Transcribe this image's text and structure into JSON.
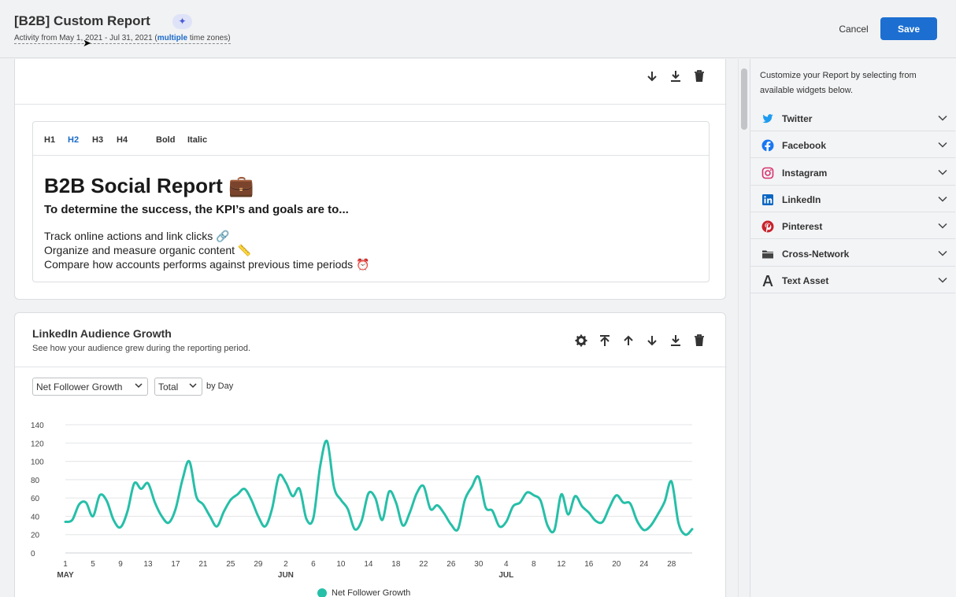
{
  "header": {
    "title": "[B2B] Custom Report",
    "subtitle_prefix": "Activity from May 1, 2021 - Jul 31, 2021 (",
    "subtitle_link": "multiple",
    "subtitle_suffix": " time zones)",
    "cancel_label": "Cancel",
    "save_label": "Save"
  },
  "editor": {
    "toolbar": [
      "H1",
      "H2",
      "H3",
      "H4",
      "Bold",
      "Italic"
    ],
    "active": "H2",
    "heading": "B2B Social Report 💼",
    "subheading": "To determine the success, the KPI’s and goals are to...",
    "lines": [
      "Track online actions and link clicks 🔗",
      "Organize and measure organic content 📏",
      "Compare how accounts performs against previous time periods ⏰"
    ]
  },
  "widget": {
    "title": "LinkedIn Audience Growth",
    "description": "See how your audience grew during the reporting period.",
    "metric_select": "Net Follower Growth",
    "aggregation_select": "Total",
    "by_label": "by Day"
  },
  "chart_data": {
    "type": "line",
    "series": [
      {
        "name": "Net Follower Growth",
        "color": "#26bfa8",
        "x": [
          "May 1",
          "May 2",
          "May 3",
          "May 4",
          "May 5",
          "May 6",
          "May 7",
          "May 8",
          "May 9",
          "May 10",
          "May 11",
          "May 12",
          "May 13",
          "May 14",
          "May 15",
          "May 16",
          "May 17",
          "May 18",
          "May 19",
          "May 20",
          "May 21",
          "May 22",
          "May 23",
          "May 24",
          "May 25",
          "May 26",
          "May 27",
          "May 28",
          "May 29",
          "May 30",
          "May 31",
          "Jun 1",
          "Jun 2",
          "Jun 3",
          "Jun 4",
          "Jun 5",
          "Jun 6",
          "Jun 7",
          "Jun 8",
          "Jun 9",
          "Jun 10",
          "Jun 11",
          "Jun 12",
          "Jun 13",
          "Jun 14",
          "Jun 15",
          "Jun 16",
          "Jun 17",
          "Jun 18",
          "Jun 19",
          "Jun 20",
          "Jun 21",
          "Jun 22",
          "Jun 23",
          "Jun 24",
          "Jun 25",
          "Jun 26",
          "Jun 27",
          "Jun 28",
          "Jun 29",
          "Jun 30",
          "Jul 1",
          "Jul 2",
          "Jul 3",
          "Jul 4",
          "Jul 5",
          "Jul 6",
          "Jul 7",
          "Jul 8",
          "Jul 9",
          "Jul 10",
          "Jul 11",
          "Jul 12",
          "Jul 13",
          "Jul 14",
          "Jul 15",
          "Jul 16",
          "Jul 17",
          "Jul 18",
          "Jul 19",
          "Jul 20",
          "Jul 21",
          "Jul 22",
          "Jul 23",
          "Jul 24",
          "Jul 25",
          "Jul 26",
          "Jul 27",
          "Jul 28",
          "Jul 29",
          "Jul 30",
          "Jul 31"
        ],
        "values": [
          34,
          36,
          53,
          55,
          40,
          63,
          57,
          36,
          28,
          45,
          76,
          70,
          76,
          55,
          40,
          33,
          48,
          80,
          100,
          62,
          53,
          40,
          29,
          45,
          58,
          64,
          70,
          58,
          40,
          29,
          48,
          84,
          77,
          62,
          70,
          37,
          38,
          95,
          122,
          72,
          58,
          48,
          26,
          35,
          65,
          60,
          36,
          67,
          55,
          30,
          44,
          65,
          73,
          48,
          52,
          43,
          31,
          26,
          58,
          72,
          83,
          50,
          46,
          29,
          34,
          51,
          55,
          66,
          63,
          57,
          30,
          25,
          64,
          42,
          62,
          51,
          44,
          35,
          34,
          50,
          63,
          55,
          54,
          35,
          25,
          30,
          42,
          56,
          78,
          33,
          20,
          26
        ]
      }
    ],
    "x_tick_labels": [
      "1",
      "5",
      "9",
      "13",
      "17",
      "21",
      "25",
      "29",
      "2",
      "6",
      "10",
      "14",
      "18",
      "22",
      "26",
      "30",
      "4",
      "8",
      "12",
      "16",
      "20",
      "24",
      "28"
    ],
    "x_month_labels": [
      "MAY",
      "JUN",
      "JUL"
    ],
    "ylim": [
      0,
      140
    ],
    "y_ticks": [
      0,
      20,
      40,
      60,
      80,
      100,
      120,
      140
    ],
    "grid": true,
    "legend": "bottom"
  },
  "panel": {
    "intro": "Customize your Report by selecting from available widgets below.",
    "widgets": [
      {
        "label": "Twitter",
        "icon": "twitter-icon",
        "color": "#1d9bf0"
      },
      {
        "label": "Facebook",
        "icon": "facebook-icon",
        "color": "#1877f2"
      },
      {
        "label": "Instagram",
        "icon": "instagram-icon",
        "color": "#d6336c"
      },
      {
        "label": "LinkedIn",
        "icon": "linkedin-icon",
        "color": "#0a66c2"
      },
      {
        "label": "Pinterest",
        "icon": "pinterest-icon",
        "color": "#c8232c"
      },
      {
        "label": "Cross-Network",
        "icon": "folder-icon",
        "color": "#444444"
      },
      {
        "label": "Text Asset",
        "icon": "text-asset-icon",
        "color": "#333333"
      }
    ]
  }
}
